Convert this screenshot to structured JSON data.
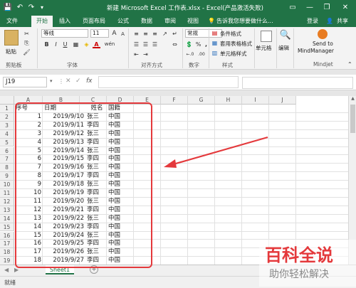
{
  "titlebar": {
    "title": "新建 Microsoft Excel 工作表.xlsx - Excel(产品激活失败)",
    "save_icon": "💾",
    "undo_icon": "↶",
    "redo_icon": "↷",
    "qat_more_icon": "▾",
    "ribbon_opts_icon": "▭",
    "minimize_icon": "—",
    "restore_icon": "❐",
    "close_icon": "✕"
  },
  "tabs": [
    "文件",
    "开始",
    "插入",
    "页面布局",
    "公式",
    "数据",
    "审阅",
    "视图"
  ],
  "tell_me": "告诉我您想要做什么...",
  "login": "登录",
  "share": "共享",
  "ribbon": {
    "paste": "粘贴",
    "font_name": "等线",
    "font_size": "11",
    "bold": "B",
    "italic": "I",
    "underline": "U",
    "font_color_glyph": "A",
    "font_grow": "A",
    "font_shrink": "A",
    "wen": "wén",
    "number_format": "常规",
    "percent": "%",
    "comma": ",",
    "inc_dec": "←.0",
    "dec_dec": ".00",
    "cond_format": "条件格式",
    "table_format": "套用表格格式",
    "cell_style": "单元格样式",
    "cells_label": "单元格",
    "edit_label": "编辑",
    "mm_line1": "Send to",
    "mm_line2": "MindManager",
    "groups": [
      "剪贴板",
      "字体",
      "对齐方式",
      "数字",
      "样式",
      "Mindjet"
    ],
    "group_label_cells": "",
    "group_label_edit": ""
  },
  "formula_bar": {
    "name_box": "J19",
    "cancel": "✕",
    "enter": "✓",
    "fx": "fx",
    "formula": ""
  },
  "columns": [
    "A",
    "B",
    "C",
    "D",
    "E",
    "F",
    "G",
    "H",
    "I",
    "J"
  ],
  "rows": [
    {
      "n": "1",
      "a": "序号",
      "b": "日期",
      "c": "姓名",
      "d": "国籍"
    },
    {
      "n": "2",
      "a": "1",
      "b": "2019/9/10",
      "c": "张三",
      "d": "中国"
    },
    {
      "n": "3",
      "a": "2",
      "b": "2019/9/11",
      "c": "李四",
      "d": "中国"
    },
    {
      "n": "4",
      "a": "3",
      "b": "2019/9/12",
      "c": "张三",
      "d": "中国"
    },
    {
      "n": "5",
      "a": "4",
      "b": "2019/9/13",
      "c": "李四",
      "d": "中国"
    },
    {
      "n": "6",
      "a": "5",
      "b": "2019/9/14",
      "c": "张三",
      "d": "中国"
    },
    {
      "n": "7",
      "a": "6",
      "b": "2019/9/15",
      "c": "李四",
      "d": "中国"
    },
    {
      "n": "8",
      "a": "7",
      "b": "2019/9/16",
      "c": "张三",
      "d": "中国"
    },
    {
      "n": "9",
      "a": "8",
      "b": "2019/9/17",
      "c": "李四",
      "d": "中国"
    },
    {
      "n": "10",
      "a": "9",
      "b": "2019/9/18",
      "c": "张三",
      "d": "中国"
    },
    {
      "n": "11",
      "a": "10",
      "b": "2019/9/19",
      "c": "李四",
      "d": "中国"
    },
    {
      "n": "12",
      "a": "11",
      "b": "2019/9/20",
      "c": "张三",
      "d": "中国"
    },
    {
      "n": "13",
      "a": "12",
      "b": "2019/9/21",
      "c": "李四",
      "d": "中国"
    },
    {
      "n": "14",
      "a": "13",
      "b": "2019/9/22",
      "c": "张三",
      "d": "中国"
    },
    {
      "n": "15",
      "a": "14",
      "b": "2019/9/23",
      "c": "李四",
      "d": "中国"
    },
    {
      "n": "16",
      "a": "15",
      "b": "2019/9/24",
      "c": "张三",
      "d": "中国"
    },
    {
      "n": "17",
      "a": "16",
      "b": "2019/9/25",
      "c": "李四",
      "d": "中国"
    },
    {
      "n": "18",
      "a": "17",
      "b": "2019/9/26",
      "c": "张三",
      "d": "中国"
    },
    {
      "n": "19",
      "a": "18",
      "b": "2019/9/27",
      "c": "李四",
      "d": "中国"
    }
  ],
  "sheet_tab": "Sheet1",
  "add_sheet": "+",
  "status": "就绪",
  "watermark": {
    "line1": "百科全说",
    "line2": "助你轻松解决"
  },
  "colors": {
    "excel_green": "#217346",
    "annotation_red": "#e4393c"
  }
}
